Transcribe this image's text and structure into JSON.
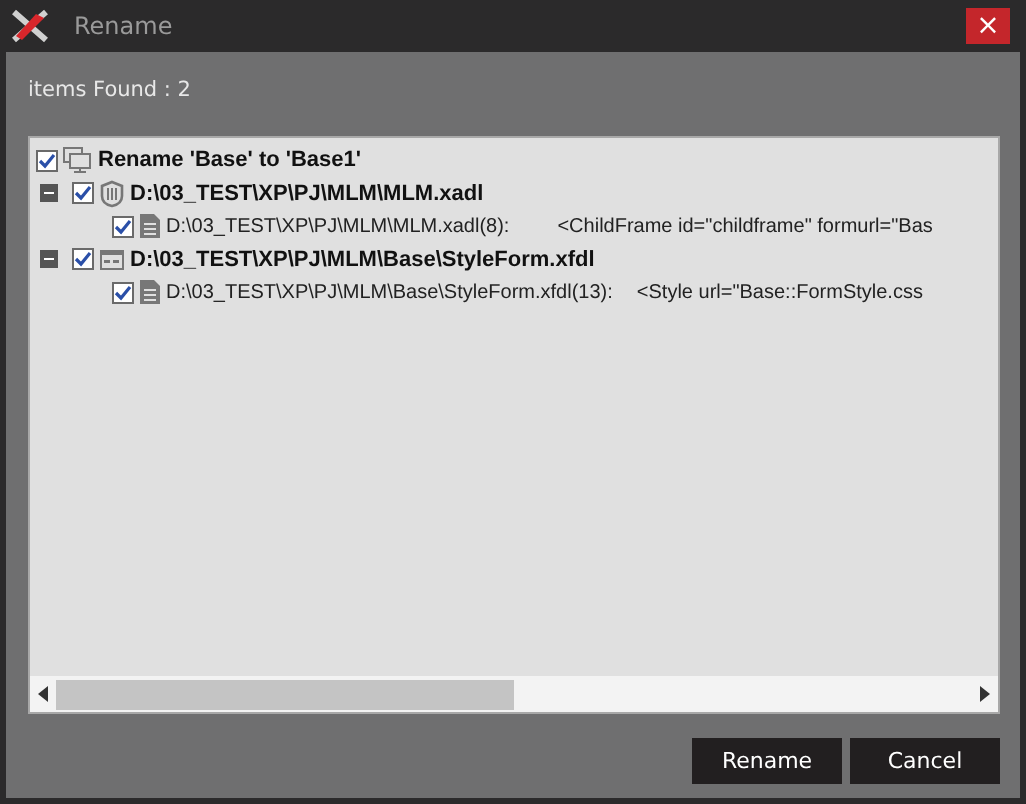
{
  "window": {
    "title": "Rename",
    "close": "×"
  },
  "summary": "items Found : 2",
  "tree": {
    "label": "Rename 'Base' to 'Base1'",
    "checked": true,
    "children": [
      {
        "kind": "module",
        "path": "D:\\03_TEST\\XP\\PJ\\MLM\\MLM.xadl",
        "checked": true,
        "expanded": true,
        "children": [
          {
            "location": "D:\\03_TEST\\XP\\PJ\\MLM\\MLM.xadl(8):",
            "match": "<ChildFrame id=\"childframe\" formurl=\"Bas",
            "checked": true
          }
        ]
      },
      {
        "kind": "form",
        "path": "D:\\03_TEST\\XP\\PJ\\MLM\\Base\\StyleForm.xfdl",
        "checked": true,
        "expanded": true,
        "children": [
          {
            "location": "D:\\03_TEST\\XP\\PJ\\MLM\\Base\\StyleForm.xfdl(13):",
            "match": "<Style url=\"Base::FormStyle.css",
            "checked": true
          }
        ]
      }
    ]
  },
  "buttons": [
    "Rename",
    "Cancel"
  ]
}
